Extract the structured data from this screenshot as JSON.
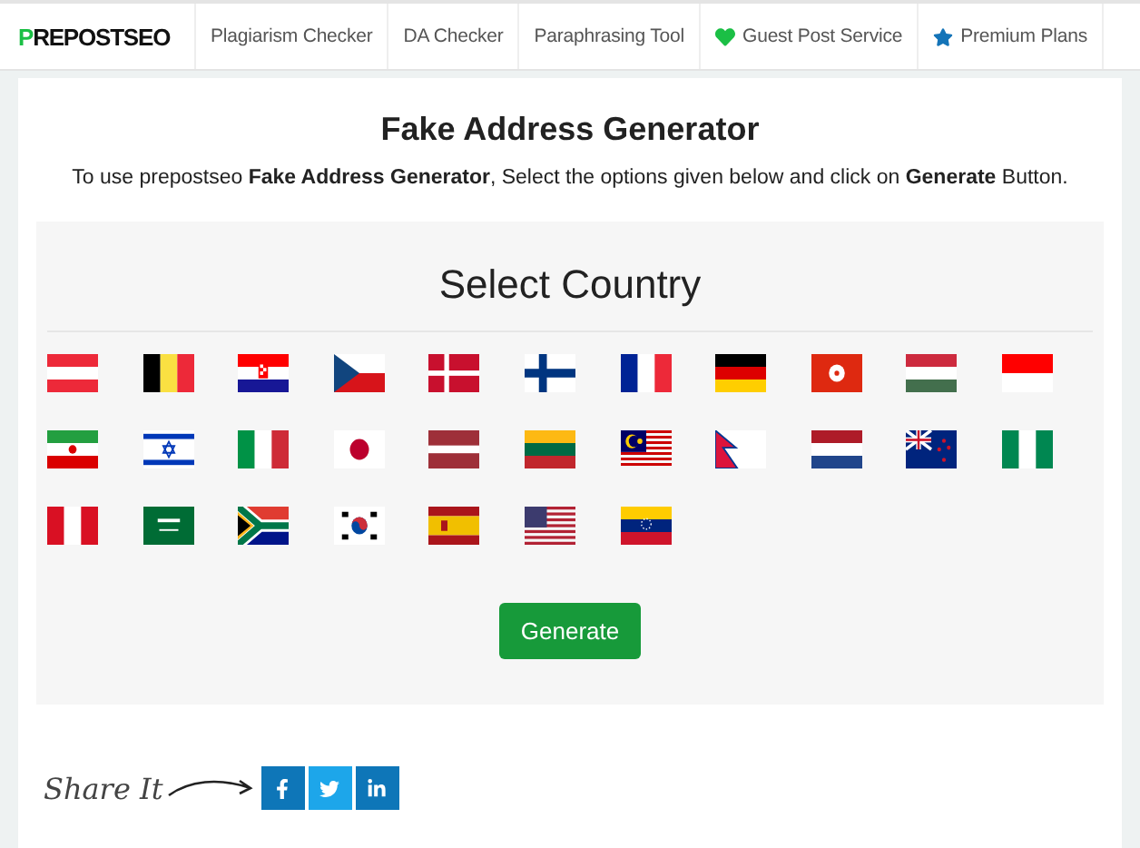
{
  "logo": "PREPOSTSEO",
  "nav": [
    {
      "label": "Plagiarism Checker",
      "kind": "plain"
    },
    {
      "label": "DA Checker",
      "kind": "plain"
    },
    {
      "label": "Paraphrasing Tool",
      "kind": "plain"
    },
    {
      "label": "Guest Post Service",
      "kind": "heart"
    },
    {
      "label": "Premium Plans",
      "kind": "star"
    }
  ],
  "title": "Fake Address Generator",
  "subtitle": "To use prepostseo **Fake Address Generator**, Select the options given below and click on **Generate** Button.",
  "panel_title": "Select Country",
  "flags": [
    {
      "kind": "at"
    },
    {
      "kind": "be"
    },
    {
      "kind": "hr"
    },
    {
      "kind": "cz"
    },
    {
      "kind": "dk"
    },
    {
      "kind": "fi"
    },
    {
      "kind": "fr"
    },
    {
      "kind": "de"
    },
    {
      "kind": "hk"
    },
    {
      "kind": "hu"
    },
    {
      "kind": "id"
    },
    {
      "kind": "ir"
    },
    {
      "kind": "il"
    },
    {
      "kind": "it"
    },
    {
      "kind": "jp"
    },
    {
      "kind": "lv"
    },
    {
      "kind": "lt"
    },
    {
      "kind": "my"
    },
    {
      "kind": "np"
    },
    {
      "kind": "nl"
    },
    {
      "kind": "nz"
    },
    {
      "kind": "ng"
    },
    {
      "kind": "pe"
    },
    {
      "kind": "sa"
    },
    {
      "kind": "za"
    },
    {
      "kind": "kr"
    },
    {
      "kind": "es"
    },
    {
      "kind": "us"
    },
    {
      "kind": "ve"
    }
  ],
  "generate_button": "Generate",
  "share_label": "Share It",
  "share_buttons": [
    {
      "kind": "facebook"
    },
    {
      "kind": "twitter"
    },
    {
      "kind": "linkedin"
    }
  ]
}
